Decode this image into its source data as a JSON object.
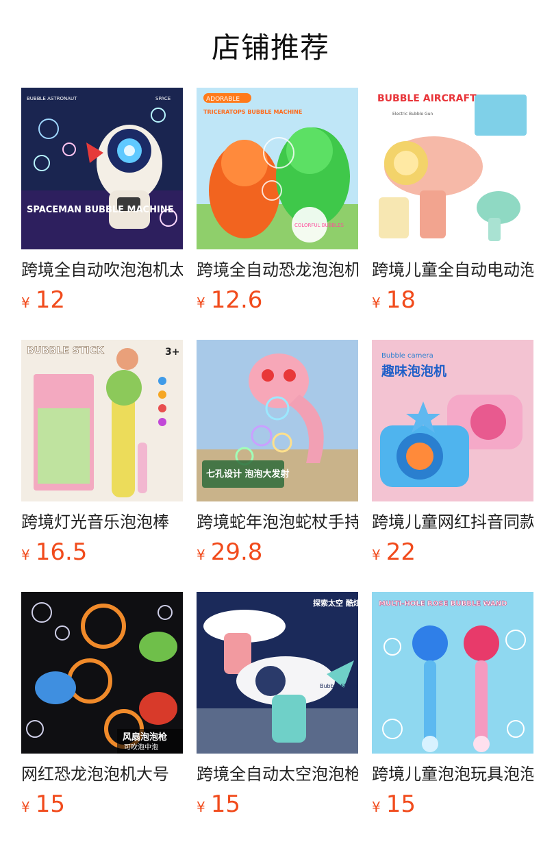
{
  "section": {
    "title": "店铺推荐"
  },
  "products": [
    {
      "name": "跨境全自动吹泡泡机太空人",
      "currency": "¥",
      "price": "12",
      "image": {
        "brand_text": "SPACEMAN BUBBLE MACHINE",
        "top_left_text": "BUBBLE ASTRONAUT",
        "top_right_text": "SPACE"
      }
    },
    {
      "name": "跨境全自动恐龙泡泡机",
      "currency": "¥",
      "price": "12.6",
      "image": {
        "top_badge": "ADORABLE",
        "brand_text": "TRICERATOPS BUBBLE MACHINE",
        "circle_text": "COLORFUL BUBBLES"
      }
    },
    {
      "name": "跨境儿童全自动电动泡泡枪",
      "currency": "¥",
      "price": "18",
      "image": {
        "brand_text": "BUBBLE AIRCRAFT",
        "sub_text": "Electric Bubble Gun"
      }
    },
    {
      "name": "跨境灯光音乐泡泡棒",
      "currency": "¥",
      "price": "16.5",
      "image": {
        "brand_text": "BUBBLE STICK",
        "age_text": "3+"
      }
    },
    {
      "name": "跨境蛇年泡泡蛇杖手持",
      "currency": "¥",
      "price": "29.8",
      "image": {
        "brand_text": "七孔设计 泡泡大发射"
      }
    },
    {
      "name": "跨境儿童网红抖音同款",
      "currency": "¥",
      "price": "22",
      "image": {
        "top_text": "Bubble camera",
        "brand_text": "趣味泡泡机"
      }
    },
    {
      "name": "网红恐龙泡泡机大号",
      "currency": "¥",
      "price": "15",
      "image": {
        "brand_text": "风扇泡泡枪",
        "sub_text": "可吹泡中泡"
      }
    },
    {
      "name": "跨境全自动太空泡泡枪",
      "currency": "¥",
      "price": "15",
      "image": {
        "brand_text": "探索太空 酷炫泡泡枪",
        "logo_text": "Bubble Storm"
      }
    },
    {
      "name": "跨境儿童泡泡玩具泡泡棒",
      "currency": "¥",
      "price": "15",
      "image": {
        "brand_text": "MULTI-HOLE ROSE BUBBLE WAND"
      }
    }
  ]
}
